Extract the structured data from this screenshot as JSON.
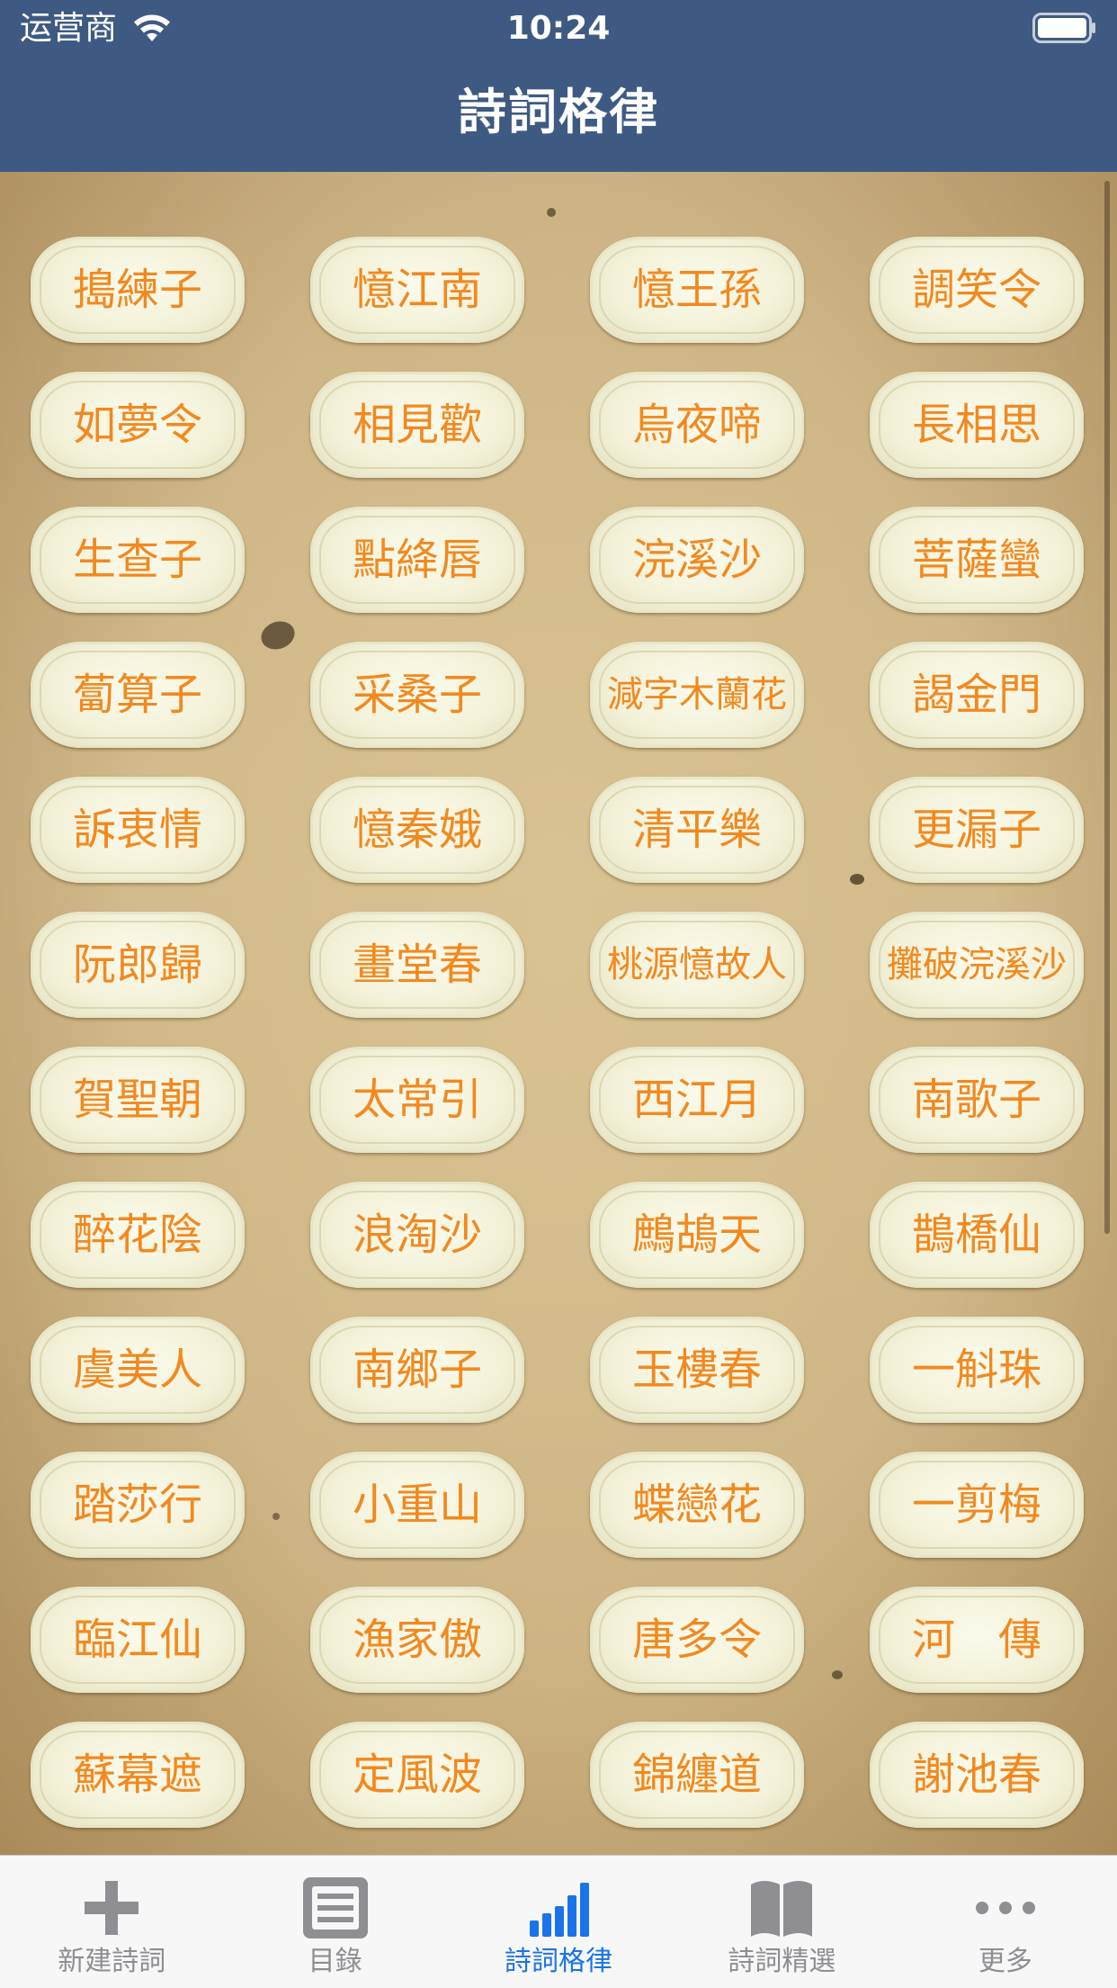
{
  "status_bar": {
    "carrier": "运营商",
    "time": "10:24"
  },
  "nav": {
    "title": "詩詞格律"
  },
  "tunes": [
    "搗練子",
    "憶江南",
    "憶王孫",
    "調笑令",
    "如夢令",
    "相見歡",
    "烏夜啼",
    "長相思",
    "生查子",
    "點絳唇",
    "浣溪沙",
    "菩薩蠻",
    "蔔算子",
    "采桑子",
    "減字木蘭花",
    "謁金門",
    "訴衷情",
    "憶秦娥",
    "清平樂",
    "更漏子",
    "阮郎歸",
    "畫堂春",
    "桃源憶故人",
    "攤破浣溪沙",
    "賀聖朝",
    "太常引",
    "西江月",
    "南歌子",
    "醉花陰",
    "浪淘沙",
    "鷓鴣天",
    "鵲橋仙",
    "虞美人",
    "南鄉子",
    "玉樓春",
    "一斛珠",
    "踏莎行",
    "小重山",
    "蝶戀花",
    "一剪梅",
    "臨江仙",
    "漁家傲",
    "唐多令",
    "河　傳",
    "蘇幕遮",
    "定風波",
    "錦纏道",
    "謝池春"
  ],
  "tabbar": {
    "active_color": "#1a73e8",
    "inactive_color": "#8e8e93",
    "tabs": [
      {
        "label": "新建詩詞",
        "icon": "plus-icon",
        "active": false
      },
      {
        "label": "目錄",
        "icon": "list-icon",
        "active": false
      },
      {
        "label": "詩詞格律",
        "icon": "bar-chart-icon",
        "active": true
      },
      {
        "label": "詩詞精選",
        "icon": "book-icon",
        "active": false
      },
      {
        "label": "更多",
        "icon": "more-icon",
        "active": false
      }
    ]
  },
  "colors": {
    "nav_background": "#3f5a82",
    "tune_text": "#f2891f"
  }
}
